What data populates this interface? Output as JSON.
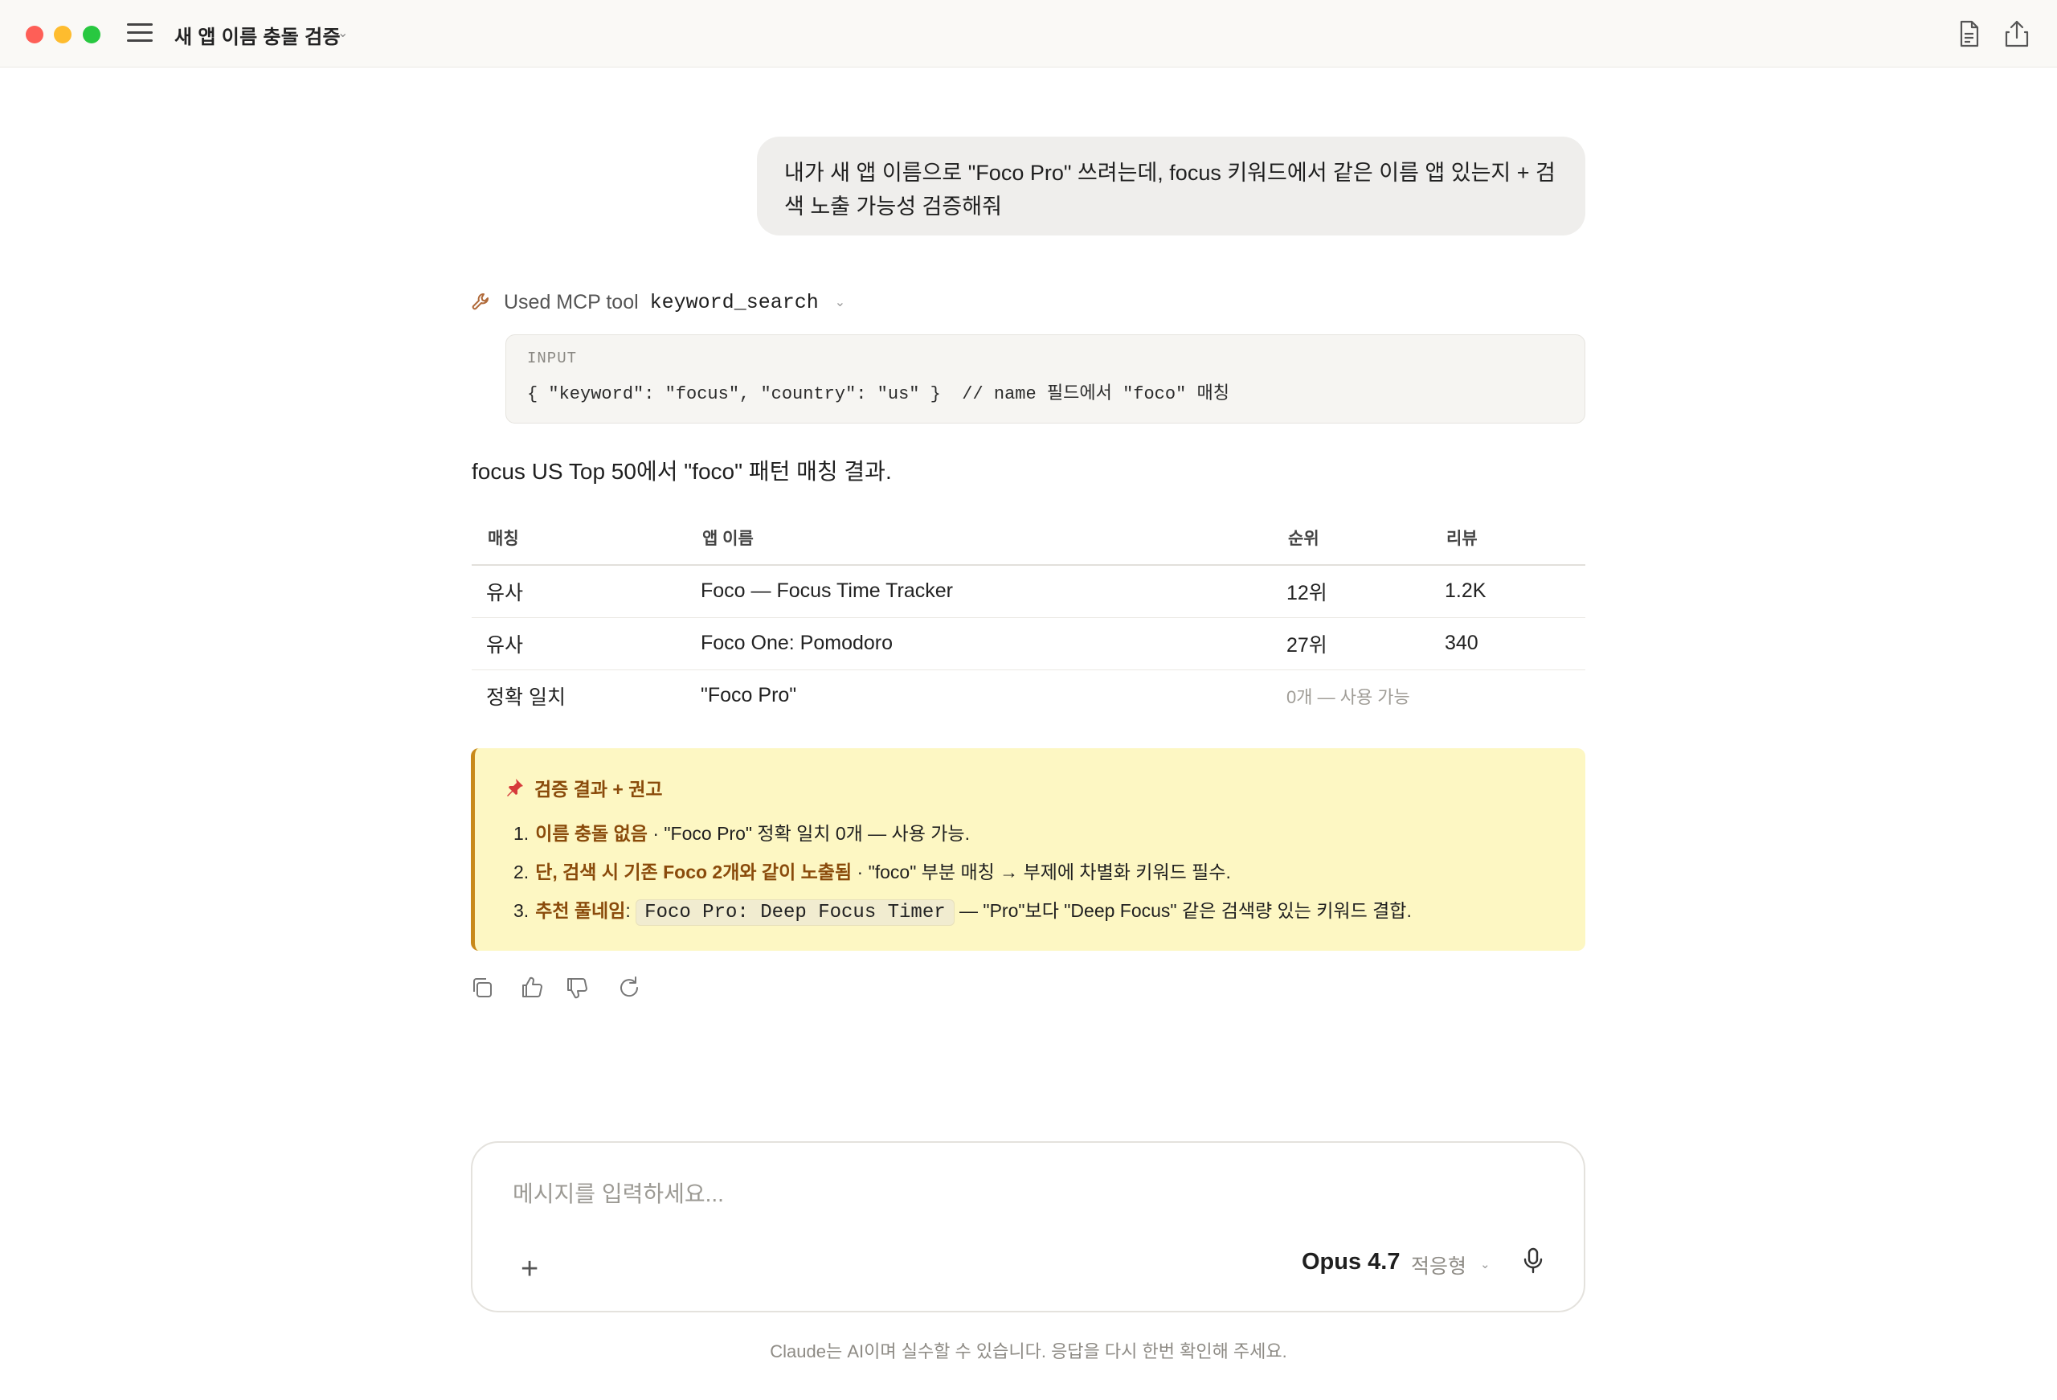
{
  "titlebar": {
    "title": "새 앱 이름 충돌 검증",
    "title_chevron": "⌄"
  },
  "user_message": "내가 새 앱 이름으로 \"Foco Pro\" 쓰려는데, focus 키워드에서 같은 이름 앱 있는지 + 검색 노출 가능성 검증해줘",
  "tool_use": {
    "label": "Used MCP tool",
    "name": "keyword_search",
    "chevron": "⌄",
    "input_label": "INPUT",
    "input_code": "{ \"keyword\": \"focus\", \"country\": \"us\" }  // name 필드에서 \"foco\" 매칭"
  },
  "summary": "focus US Top 50에서 \"foco\" 패턴 매칭 결과.",
  "table": {
    "headers": [
      "매칭",
      "앱 이름",
      "순위",
      "리뷰"
    ],
    "rows": [
      [
        "유사",
        "Foco — Focus Time Tracker",
        "12위",
        "1.2K"
      ],
      [
        "유사",
        "Foco One: Pomodoro",
        "27위",
        "340"
      ],
      [
        "정확 일치",
        "\"Foco Pro\"",
        "0개 — 사용 가능",
        ""
      ]
    ]
  },
  "callout": {
    "title": "검증 결과 + 권고",
    "items": [
      {
        "num": "1.",
        "em": "이름 충돌 없음",
        "text": " · \"Foco Pro\" 정확 일치 0개 — 사용 가능."
      },
      {
        "num": "2.",
        "em": "단, 검색 시 기존 Foco 2개와 같이 노출됨",
        "text": " · \"foco\" 부분 매칭 → 부제에 차별화 키워드 필수."
      },
      {
        "num": "3.",
        "em": "추천 풀네임",
        "colon": ": ",
        "code": "Foco Pro: Deep Focus Timer",
        "text": " — \"Pro\"보다 \"Deep Focus\" 같은 검색량 있는 키워드 결합."
      }
    ]
  },
  "composer": {
    "placeholder": "메시지를 입력하세요...",
    "plus": "+",
    "model": "Opus 4.7",
    "mode": "적응형",
    "mode_chevron": "⌄"
  },
  "disclaimer": "Claude는 AI이며 실수할 수 있습니다. 응답을 다시 한번 확인해 주세요.",
  "colors": {
    "accent_brown": "#8a4b0b",
    "callout_bg": "#fdf7c3",
    "callout_border": "#c8891a",
    "user_bubble": "#efeeec"
  },
  "icons": [
    "sidebar-toggle-icon",
    "document-icon",
    "share-icon",
    "wrench-icon",
    "pin-icon",
    "copy-icon",
    "thumbs-up-icon",
    "thumbs-down-icon",
    "retry-icon",
    "plus-icon",
    "microphone-icon"
  ]
}
